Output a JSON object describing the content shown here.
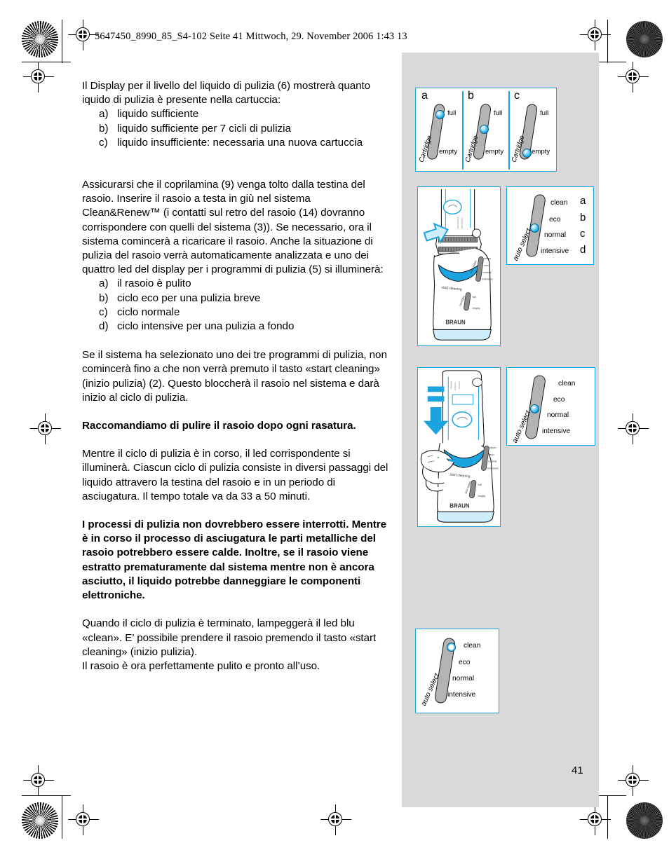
{
  "header": {
    "file_line": "5647450_8990_85_S4-102  Seite 41  Mittwoch, 29. November 2006  1:43 13"
  },
  "page": {
    "number": "41"
  },
  "body": {
    "paragraph_1": "Il Display per il livello del liquido di pulizia (6) mostrerà quanto iquido di pulizia è presente nella cartuccia:",
    "list_1": [
      {
        "marker": "a)",
        "text": "liquido sufficiente"
      },
      {
        "marker": "b)",
        "text": "liquido sufficiente per 7 cicli di pulizia"
      },
      {
        "marker": "c)",
        "text": "liquido insufficiente: necessaria una nuova cartuccia"
      }
    ],
    "paragraph_2": "Assicurarsi che il coprilamina (9) venga tolto dalla testina del rasoio. Inserire il rasoio a testa in giù nel sistema Clean&Renew™ (i contatti sul retro del rasoio (14) dovranno corrispondere con quelli del sistema (3)). Se necessario, ora il sistema comincerà a ricaricare il rasoio. Anche la situazione di pulizia del rasoio verrà automaticamente analizzata e uno dei quattro led del display per i programmi di pulizia (5) si illuminerà:",
    "list_2": [
      {
        "marker": "a)",
        "text": "il rasoio è pulito"
      },
      {
        "marker": "b)",
        "text": "ciclo eco per una pulizia breve"
      },
      {
        "marker": "c)",
        "text": "ciclo normale"
      },
      {
        "marker": "d)",
        "text": "ciclo intensive per una pulizia a fondo"
      }
    ],
    "paragraph_3": "Se il sistema ha selezionato uno dei tre programmi di pulizia, non comincerà fino a che non verrà premuto il tasto «start cleaning» (inizio pulizia) (2). Questo bloccherà il rasoio nel sistema e darà inizio al ciclo di pulizia.",
    "paragraph_4_bold": "Raccomandiamo di pulire il rasoio dopo ogni rasatura.",
    "paragraph_5": "Mentre il ciclo di pulizia è in corso, il led corrispondente si illuminerà. Ciascun ciclo di pulizia consiste in diversi passaggi del liquido attravero la testina del rasoio e in un periodo di asciugatura. Il tempo totale va da 33 a 50 minuti.",
    "paragraph_6_bold": "I processi di pulizia non dovrebbero essere interrotti. Mentre è in corso il processo di asciugatura le parti metalliche del rasoio potrebbero essere calde. Inoltre, se il rasoio viene estratto prematuramente dal sistema mentre non è ancora asciutto, il liquido potrebbe danneggiare le componenti elettroniche.",
    "paragraph_7": "Quando il ciclo di pulizia è terminato, lampeggerà il led blu «clean». E’ possibile prendere il rasoio premendo il tasto «start cleaning» (inizio pulizia).",
    "paragraph_8": "Il rasoio è ora perfettamente pulito e pronto all’uso."
  },
  "figures": {
    "cartridge_panel": {
      "cells": [
        {
          "letter": "a",
          "vertical_label": "Cartridge",
          "top_label": "full",
          "bottom_label": "empty",
          "led_position": "full"
        },
        {
          "letter": "b",
          "vertical_label": "Cartridge",
          "top_label": "full",
          "bottom_label": "empty",
          "led_position": "middle"
        },
        {
          "letter": "c",
          "vertical_label": "Cartridge",
          "top_label": "full",
          "bottom_label": "empty",
          "led_position": "empty"
        }
      ]
    },
    "auto_select_1": {
      "vertical_label": "auto select",
      "labels": [
        "clean",
        "eco",
        "normal",
        "intensive"
      ],
      "letters": [
        "a",
        "b",
        "c",
        "d"
      ],
      "led_position": "normal"
    },
    "auto_select_2": {
      "vertical_label": "auto select",
      "labels": [
        "clean",
        "eco",
        "normal",
        "intensive"
      ],
      "led_position": "normal"
    },
    "auto_select_3": {
      "vertical_label": "auto select",
      "labels": [
        "clean",
        "eco",
        "normal",
        "intensive"
      ],
      "led_position": "clean"
    },
    "device_insert": {
      "caption": "shaver-inserted-into-station"
    },
    "device_press": {
      "caption": "hand-pressing-start-cleaning-button"
    }
  },
  "colors": {
    "accent_blue": "#1ba3e0",
    "led_blue": "#00a0e0",
    "panel_grey": "#d9d9d9",
    "bar_grey": "#b3b3b3"
  }
}
